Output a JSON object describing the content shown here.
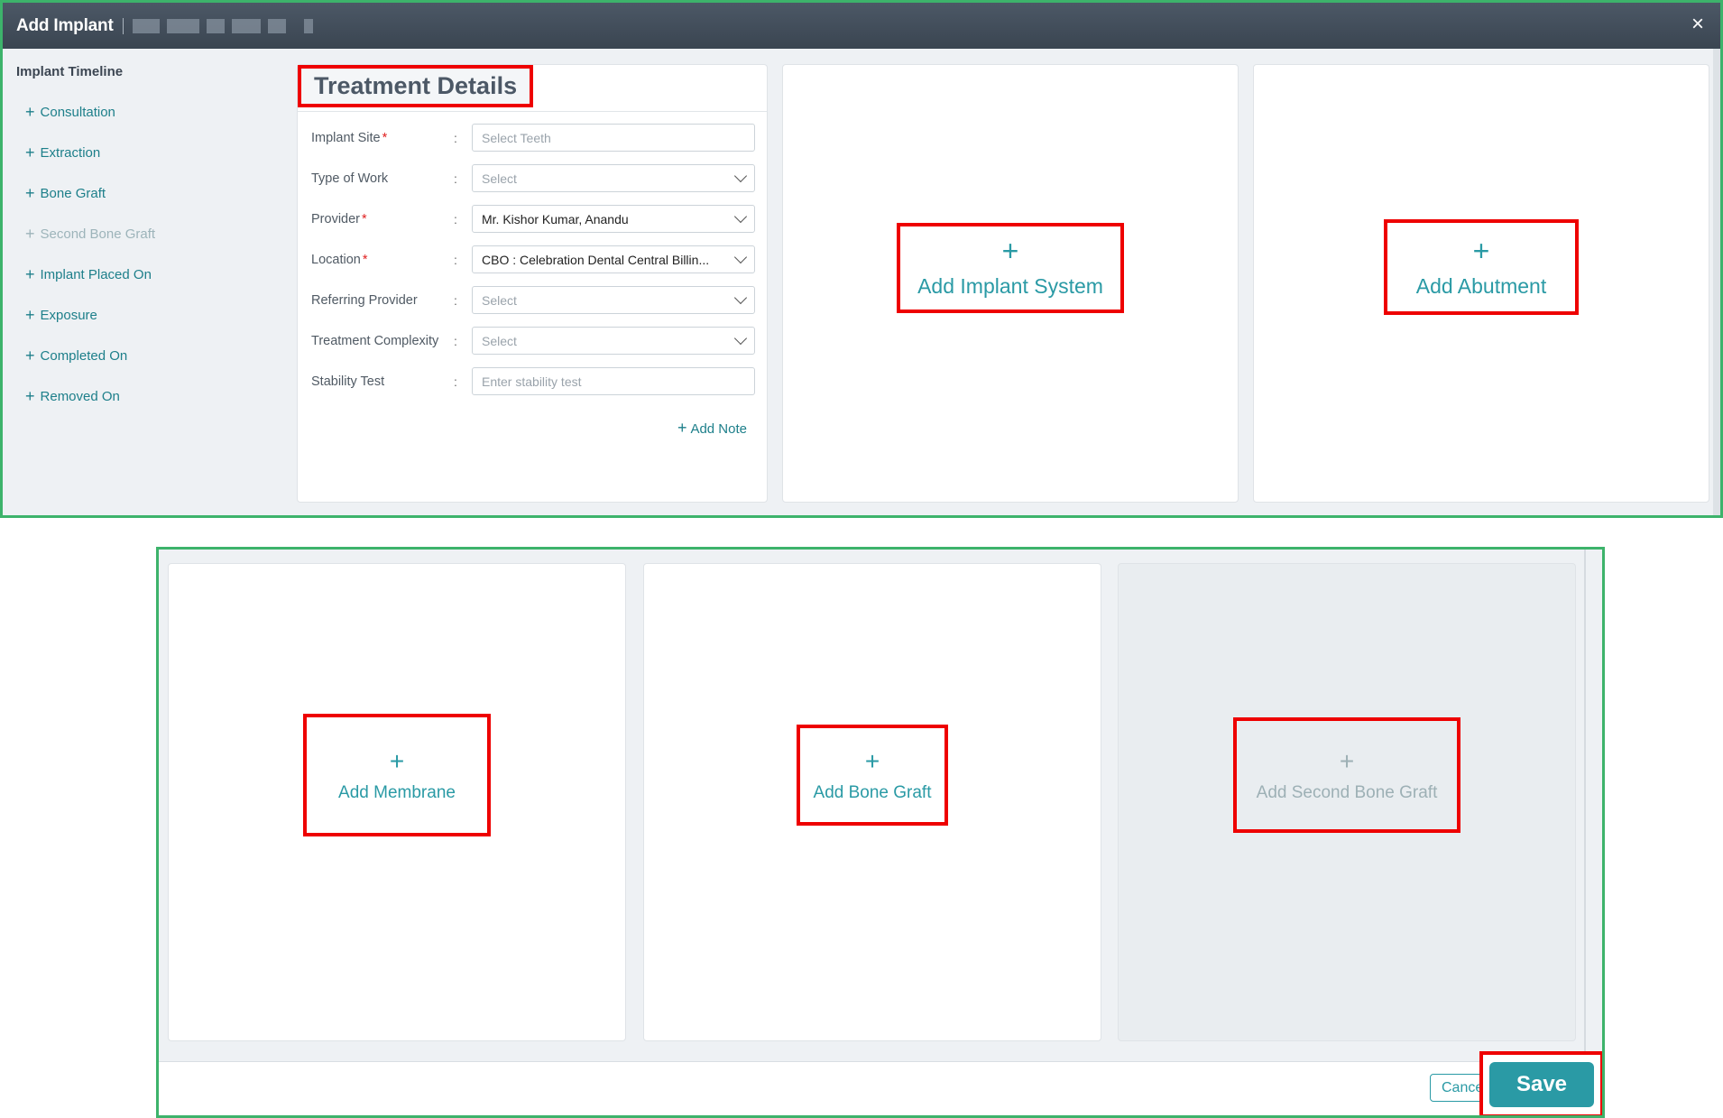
{
  "window": {
    "title": "Add Implant",
    "close_glyph": "×"
  },
  "sidebar": {
    "heading": "Implant Timeline",
    "items": [
      {
        "label": "Consultation",
        "enabled": true
      },
      {
        "label": "Extraction",
        "enabled": true
      },
      {
        "label": "Bone Graft",
        "enabled": true
      },
      {
        "label": "Second Bone Graft",
        "enabled": false
      },
      {
        "label": "Implant Placed On",
        "enabled": true
      },
      {
        "label": "Exposure",
        "enabled": true
      },
      {
        "label": "Completed On",
        "enabled": true
      },
      {
        "label": "Removed On",
        "enabled": true
      }
    ]
  },
  "treatment": {
    "heading": "Treatment Details",
    "fields": [
      {
        "label": "Implant Site",
        "required": true,
        "value": "",
        "placeholder": "Select Teeth",
        "type": "input"
      },
      {
        "label": "Type of Work",
        "required": false,
        "value": "",
        "placeholder": "Select",
        "type": "select"
      },
      {
        "label": "Provider",
        "required": true,
        "value": "Mr. Kishor Kumar, Anandu",
        "placeholder": "Select",
        "type": "select"
      },
      {
        "label": "Location",
        "required": true,
        "value": "CBO : Celebration Dental Central Billin...",
        "placeholder": "Select",
        "type": "select"
      },
      {
        "label": "Referring Provider",
        "required": false,
        "value": "",
        "placeholder": "Select",
        "type": "select"
      },
      {
        "label": "Treatment Complexity",
        "required": false,
        "value": "",
        "placeholder": "Select",
        "type": "select"
      },
      {
        "label": "Stability Test",
        "required": false,
        "value": "",
        "placeholder": "Enter stability test",
        "type": "input"
      }
    ],
    "colon": ":",
    "add_note": "Add Note"
  },
  "cards": {
    "implant_system": "Add Implant System",
    "abutment": "Add Abutment",
    "membrane": "Add Membrane",
    "bone_graft": "Add Bone Graft",
    "second_bone_graft": "Add Second Bone Graft"
  },
  "footer": {
    "cancel": "Cancel",
    "save": "Save"
  },
  "colors": {
    "accent": "#2a9aa5",
    "highlight_border": "#e00000",
    "panel_border": "#3db36b",
    "titlebar": "#3f4a56"
  }
}
